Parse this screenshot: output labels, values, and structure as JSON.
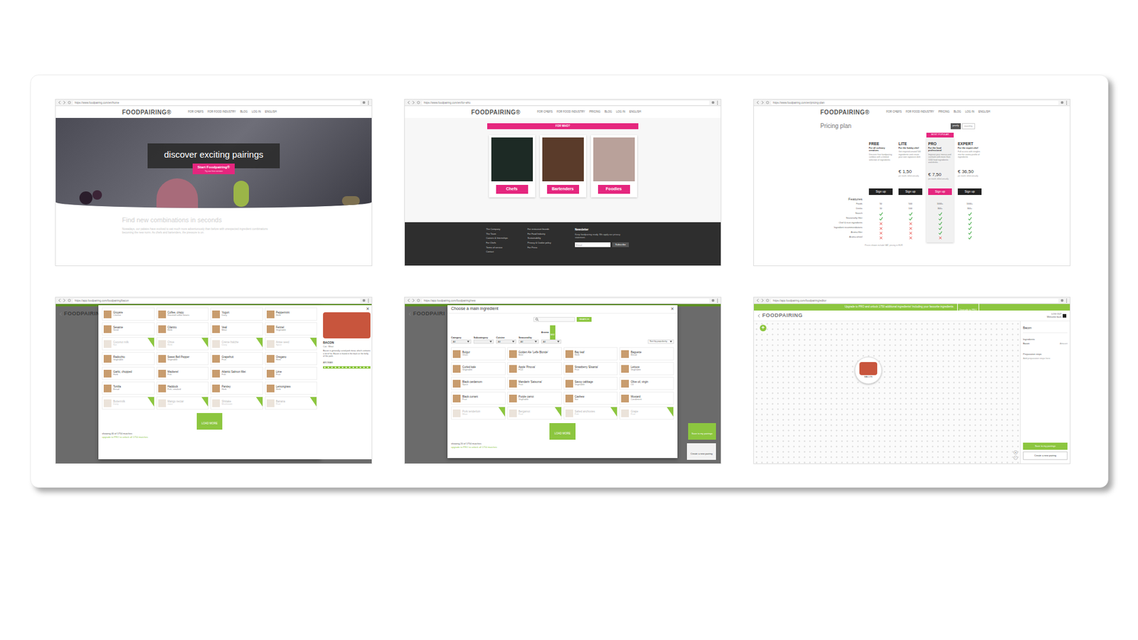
{
  "home": {
    "url": "https://www.foodpairing.com/en/home",
    "logo": "FOODPAIRING®",
    "nav": [
      "FOR CHEFS",
      "FOR FOOD INDUSTRY",
      "BLOG",
      "LOG IN",
      "ENGLISH"
    ],
    "hero_title": "discover exciting pairings",
    "cta": "Start Foodpairing®",
    "cta_sub": "Try our free version",
    "section_title": "Find new combinations in seconds",
    "section_text": "Nowadays, our palates have evolved to eat much more adventurously than before with unexpected ingredient combinations becoming the new norm. As chefs and bartenders, the pressure is on."
  },
  "for_who": {
    "url": "https://www.foodpairing.com/en/for-who",
    "logo": "FOODPAIRING®",
    "nav": [
      "FOR CHEFS",
      "FOR FOOD INDUSTRY",
      "PRICING",
      "BLOG",
      "LOG IN",
      "ENGLISH"
    ],
    "title": "FOR WHO?",
    "cards": [
      "Chefs",
      "Bartenders",
      "Foodies"
    ],
    "footer_links_1": [
      "The Company",
      "The Team",
      "Careers & Internships",
      "For Chefs",
      "Terms of service",
      "Contact"
    ],
    "footer_links_2": [
      "For restaurant brands",
      "For Food Industry",
      "Sustainability",
      "Privacy & Cookie policy",
      "For Press"
    ],
    "newsletter_title": "Newsletter",
    "newsletter_text": "Keep foodpairing ready. We apply our privacy statement.",
    "email_placeholder": "Email",
    "subscribe": "Subscribe"
  },
  "pricing": {
    "url": "https://www.foodpairing.com/en/pricing-plan",
    "logo": "FOODPAIRING®",
    "nav": [
      "FOR CHEFS",
      "FOR FOOD INDUSTRY",
      "PRICING",
      "BLOG",
      "LOG IN",
      "ENGLISH"
    ],
    "title": "Pricing plan",
    "toggle": [
      {
        "label": "yearly",
        "selected": true
      },
      {
        "label": "monthly",
        "selected": false
      }
    ],
    "plans": [
      {
        "name": "FREE",
        "tagline": "For all culinary creatives",
        "desc": "Discover free foodpairing combos with a limited selection of ingredients",
        "price": "",
        "note": "",
        "button": "Sign up",
        "popular": false
      },
      {
        "name": "LITE",
        "tagline": "For the hobby chef",
        "desc": "Get inspired around 500 ingredients and create your own signature dish",
        "price": "€ 1,50",
        "note": "per month, billed annually",
        "button": "Sign up",
        "popular": false
      },
      {
        "name": "PRO",
        "tagline": "For the food professional",
        "desc": "Improve your menus and cocktails with more than 1000 food ingredients and drinks",
        "price": "€ 7,50",
        "note": "per month, billed annually",
        "button": "Sign up",
        "popular": true,
        "badge": "MOST POPULAR"
      },
      {
        "name": "EXPERT",
        "tagline": "For the expert chef",
        "desc": "Full access with insights into the aroma profile of ingredients",
        "price": "€ 36,50",
        "note": "per month, billed annually",
        "button": "Sign up",
        "popular": false
      }
    ],
    "features_title": "Features",
    "features": [
      {
        "label": "Foods",
        "kind": "text",
        "values": [
          "50",
          "500",
          "1000+",
          "1000+"
        ]
      },
      {
        "label": "Drinks",
        "kind": "text",
        "values": [
          "10",
          "100",
          "300+",
          "300+"
        ]
      },
      {
        "label": "Search",
        "kind": "check",
        "included": [
          true,
          true,
          true,
          true
        ]
      },
      {
        "label": "Seasonality filter",
        "kind": "check",
        "included": [
          true,
          true,
          true,
          true
        ]
      },
      {
        "label": "Chef & trust ingredients",
        "kind": "check",
        "included": [
          false,
          false,
          true,
          true
        ]
      },
      {
        "label": "Ingredient recommendations",
        "kind": "check",
        "included": [
          false,
          false,
          true,
          true
        ]
      },
      {
        "label": "Aroma filter",
        "kind": "check",
        "included": [
          false,
          false,
          true,
          true
        ]
      },
      {
        "label": "Aroma wheel",
        "kind": "check",
        "included": [
          false,
          false,
          false,
          true
        ]
      }
    ],
    "footnote": "Prices shown include VAT, pricing in EUR"
  },
  "pairing_results": {
    "url": "https://app.foodpairing.com/foodpairing/bacon",
    "logo": "FOODPAIRING",
    "items": [
      {
        "name": "Gruyère",
        "sub": "Cheese",
        "locked": false
      },
      {
        "name": "Coffee, crispy",
        "sub": "Roasted coffee beans",
        "locked": false
      },
      {
        "name": "Yogurt",
        "sub": "Dairy",
        "locked": false
      },
      {
        "name": "Peppermint",
        "sub": "Herb",
        "locked": false
      },
      {
        "name": "Sesame",
        "sub": "Seed",
        "locked": false
      },
      {
        "name": "Cilantro",
        "sub": "Herb",
        "locked": false
      },
      {
        "name": "Veal",
        "sub": "Meat",
        "locked": false
      },
      {
        "name": "Fennel",
        "sub": "Vegetable",
        "locked": false
      },
      {
        "name": "Coconut milk",
        "sub": "Nut",
        "locked": true
      },
      {
        "name": "Chive",
        "sub": "Herb",
        "locked": true
      },
      {
        "name": "Crème fraîche",
        "sub": "Dairy",
        "locked": true
      },
      {
        "name": "Anise seed",
        "sub": "Spice",
        "locked": true
      },
      {
        "name": "Radicchio",
        "sub": "Vegetable",
        "locked": false
      },
      {
        "name": "Sweet Bell Pepper",
        "sub": "Vegetable",
        "locked": false
      },
      {
        "name": "Grapefruit",
        "sub": "Fruit",
        "locked": false
      },
      {
        "name": "Oregano",
        "sub": "Herb",
        "locked": false
      },
      {
        "name": "Garlic, chopped",
        "sub": "Herb",
        "locked": false
      },
      {
        "name": "Mackerel",
        "sub": "Fish",
        "locked": false
      },
      {
        "name": "Atlantic Salmon fillet",
        "sub": "Fish",
        "locked": false
      },
      {
        "name": "Lime",
        "sub": "Fruit",
        "locked": false
      },
      {
        "name": "Tortilla",
        "sub": "Bread",
        "locked": false
      },
      {
        "name": "Haddock",
        "sub": "Fish, smoked",
        "locked": false
      },
      {
        "name": "Parsley",
        "sub": "Herb",
        "locked": false
      },
      {
        "name": "Lemongrass",
        "sub": "Herb",
        "locked": false
      },
      {
        "name": "Buttermilk",
        "sub": "Dairy",
        "locked": true
      },
      {
        "name": "Mango nectar",
        "sub": "Juice",
        "locked": true
      },
      {
        "name": "Shiitake",
        "sub": "Mushroom",
        "locked": true
      },
      {
        "name": "Banana",
        "sub": "Fruit",
        "locked": true
      }
    ],
    "close": "×",
    "detail_title": "BACON",
    "detail_sub": "Cat.: Meat",
    "detail_text": "Bacon is generally cured pork meat, which contains a lot of fat. Bacon is found in the back or the belly of the pork.",
    "aromas_label": "AROMAS",
    "load_more": "LOAD MORE",
    "showing": "showing 40 of 1750 matches",
    "upgrade": "upgrade to PRO to unlock all 1750 matches"
  },
  "choose_ingredient": {
    "url": "https://app.foodpairing.com/foodpairing/new",
    "logo": "FOODPAIRI",
    "title": "Choose a main ingredient",
    "close": "×",
    "search_button": "SEARCH",
    "filters": [
      {
        "label": "Category",
        "value": "All",
        "badge": ""
      },
      {
        "label": "Subcategory",
        "value": "",
        "badge": ""
      },
      {
        "label": "Cuisine",
        "value": "All",
        "badge": ""
      },
      {
        "label": "Seasonality",
        "value": "All",
        "badge": ""
      },
      {
        "label": "Aroma",
        "value": "All",
        "badge": "NEW"
      }
    ],
    "sort": "Sort by popularity",
    "items": [
      {
        "name": "Bulgur",
        "sub": "Grain",
        "locked": false
      },
      {
        "name": "Golden Ale 'Leffe Blonde'",
        "sub": "Beer",
        "locked": false
      },
      {
        "name": "Bay leaf",
        "sub": "Herb",
        "locked": false
      },
      {
        "name": "Baguette",
        "sub": "Bread",
        "locked": false
      },
      {
        "name": "Curled kale",
        "sub": "Vegetable",
        "locked": false
      },
      {
        "name": "Apple 'Pinova'",
        "sub": "Fruit",
        "locked": false
      },
      {
        "name": "Strawberry 'Elsanta'",
        "sub": "Fruit",
        "locked": false
      },
      {
        "name": "Lettuce",
        "sub": "Vegetable",
        "locked": false
      },
      {
        "name": "Black cardamom",
        "sub": "Spice",
        "locked": false
      },
      {
        "name": "Mandarin 'Satsuma'",
        "sub": "Fruit",
        "locked": false
      },
      {
        "name": "Savoy cabbage",
        "sub": "Vegetable",
        "locked": false
      },
      {
        "name": "Olive oil, virgin",
        "sub": "Oil",
        "locked": false
      },
      {
        "name": "Black currant",
        "sub": "Fruit",
        "locked": false
      },
      {
        "name": "Purple carrot",
        "sub": "Vegetable",
        "locked": false
      },
      {
        "name": "Cashew",
        "sub": "Nut",
        "locked": false
      },
      {
        "name": "Mustard",
        "sub": "Condiment",
        "locked": false
      },
      {
        "name": "Pork tenderloin",
        "sub": "Meat",
        "locked": true
      },
      {
        "name": "Bergamot",
        "sub": "Fruit",
        "locked": true
      },
      {
        "name": "Salted anchovies",
        "sub": "Fish",
        "locked": true
      },
      {
        "name": "Grape",
        "sub": "Fruit",
        "locked": true
      }
    ],
    "load_more": "LOAD MORE",
    "showing": "showing 20 of 1750 matches",
    "upgrade": "upgrade to PRO to unlock all 1750 matches",
    "bg_save": "Save to my pairings",
    "bg_create": "Create a new pairing"
  },
  "editor": {
    "url": "https://app.foodpairing.com/foodpairing/editor",
    "banner": "Upgrade to PRO and unlock 1750 additional ingredients! Including your favourite ingredients",
    "banner_button": "Upgrade to PRO",
    "logo": "FOODPAIRING",
    "user_line1": "LOG OUT",
    "user_line2": "Welcome back",
    "add": "+",
    "node_label": "BACON",
    "zoom_in": "+",
    "zoom_out": "−",
    "sidebar_title": "Bacon",
    "ingredients_label": "Ingredients",
    "ingredients": [
      {
        "name": "Bacon",
        "amount": "Amount"
      }
    ],
    "steps_label": "Preparation steps",
    "steps_hint": "Add preparation steps here",
    "save": "Save to my pairings",
    "create": "Create a new pairing"
  }
}
